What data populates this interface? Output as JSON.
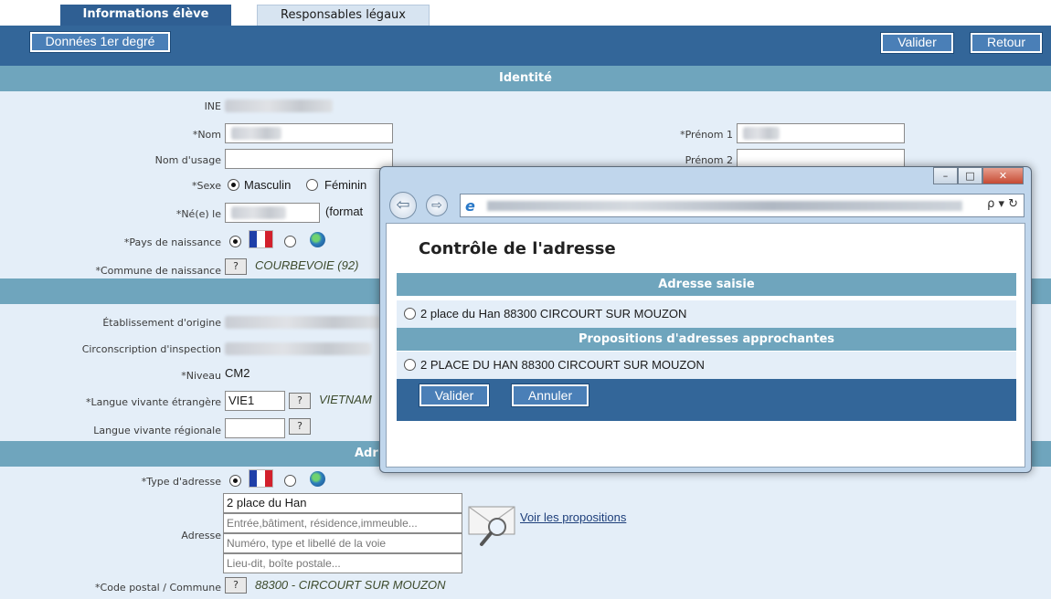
{
  "tabs": [
    {
      "label": "Informations élève",
      "active": true
    },
    {
      "label": "Responsables légaux",
      "active": false
    }
  ],
  "toolbar": {
    "donnees_label": "Données 1er degré",
    "valider_label": "Valider",
    "retour_label": "Retour"
  },
  "sections": {
    "identite": "Identité",
    "adresse_partial": "Adr"
  },
  "fields": {
    "ine_label": "INE",
    "nom_label": "*Nom",
    "prenom1_label": "*Prénom 1",
    "nom_usage_label": "Nom d'usage",
    "prenom2_label": "Prénom 2",
    "sexe_label": "*Sexe",
    "sexe_m": "Masculin",
    "sexe_f": "Féminin",
    "ne_le_label": "*Né(e) le",
    "format_hint": "(format",
    "pays_label": "*Pays de naissance",
    "commune_label": "*Commune de naissance",
    "commune_value": "COURBEVOIE (92)",
    "etab_label": "Établissement d'origine",
    "circ_label": "Circonscription d'inspection",
    "niveau_label": "*Niveau",
    "niveau_value": "CM2",
    "lve_label": "*Langue vivante étrangère",
    "lve_value": "VIE1",
    "lve_name": "VIETNAM",
    "lvr_label": "Langue vivante régionale",
    "question": "?",
    "type_adresse_label": "*Type d'adresse",
    "adresse_label": "Adresse",
    "adresse_line1": "2 place du Han",
    "adresse_ph2": "Entrée,bâtiment, résidence,immeuble...",
    "adresse_ph3": "Numéro, type et libellé de la voie",
    "adresse_ph4": "Lieu-dit, boîte postale...",
    "voir_propositions": "Voir les propositions",
    "cp_label": "*Code postal / Commune",
    "cp_value": "88300 - CIRCOURT SUR MOUZON"
  },
  "popup": {
    "title": "Contrôle de l'adresse",
    "saisie_header": "Adresse saisie",
    "saisie_value": "2 place du Han 88300 CIRCOURT SUR MOUZON",
    "propositions_header": "Propositions d'adresses approchantes",
    "proposition_value": "2 PLACE DU HAN 88300 CIRCOURT SUR MOUZON",
    "valider_label": "Valider",
    "annuler_label": "Annuler",
    "search_glyph": "ρ ▾ ↻"
  },
  "colors": {
    "header_blue": "#336699",
    "section_teal": "#6fa5bd",
    "form_bg": "#e4eef8"
  }
}
